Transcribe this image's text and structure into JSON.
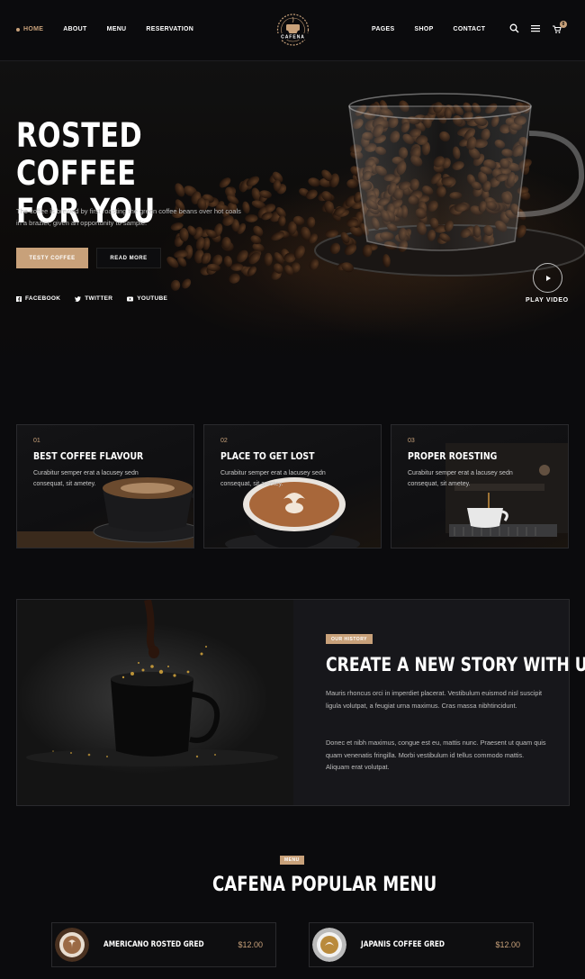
{
  "nav": {
    "left": [
      "HOME",
      "ABOUT",
      "MENU",
      "RESERVATION"
    ],
    "right": [
      "PAGES",
      "SHOP",
      "CONTACT"
    ],
    "logo_text": "CAFENA",
    "icons": [
      "search-icon",
      "hamburger-icon",
      "cart-icon"
    ],
    "cart_count": "0"
  },
  "hero": {
    "title_line1": "ROSTED COFFEE",
    "title_line2": "FOR YOU",
    "description": "The coffee is brewed by first roasting the green coffee beans over hot coals in a brazier, given an opportunity to sample.",
    "primary_button": "TESTY COFFEE",
    "secondary_button": "READ MORE",
    "socials": [
      {
        "label": "FACEBOOK",
        "icon": "facebook-icon"
      },
      {
        "label": "TWITTER",
        "icon": "twitter-icon"
      },
      {
        "label": "YOUTUBE",
        "icon": "youtube-icon"
      }
    ],
    "play_label": "PLAY VIDEO"
  },
  "features": [
    {
      "num": "01",
      "title": "BEST COFFEE FLAVOUR",
      "text": "Curabitur semper erat a lacusey sedn consequat, sit ametey."
    },
    {
      "num": "02",
      "title": "PLACE TO GET LOST",
      "text": "Curabitur semper erat a lacusey sedn consequat, sit ametey."
    },
    {
      "num": "03",
      "title": "PROPER ROESTING",
      "text": "Curabitur semper erat a lacusey sedn consequat, sit ametey."
    }
  ],
  "story": {
    "tag": "OUR HISTORY",
    "title": "CREATE A NEW STORY WITH US",
    "p1": "Mauris rhoncus orci in imperdiet placerat. Vestibulum euismod nisl suscipit ligula volutpat, a feugiat urna maximus. Cras massa nibhtincidunt.",
    "p2": "Donec et nibh maximus, congue est eu, mattis nunc. Praesent ut quam quis quam venenatis fringilla. Morbi vestibulum id tellus commodo mattis. Aliquam erat volutpat."
  },
  "menu": {
    "tag": "MENU",
    "title": "CAFENA POPULAR MENU",
    "items": [
      {
        "name": "AMERICANO ROSTED GRED",
        "price": "$12.00"
      },
      {
        "name": "JAPANIS COFFEE GRED",
        "price": "$12.00"
      }
    ]
  },
  "colors": {
    "accent": "#c8a17a",
    "background": "#0b0b0d"
  }
}
